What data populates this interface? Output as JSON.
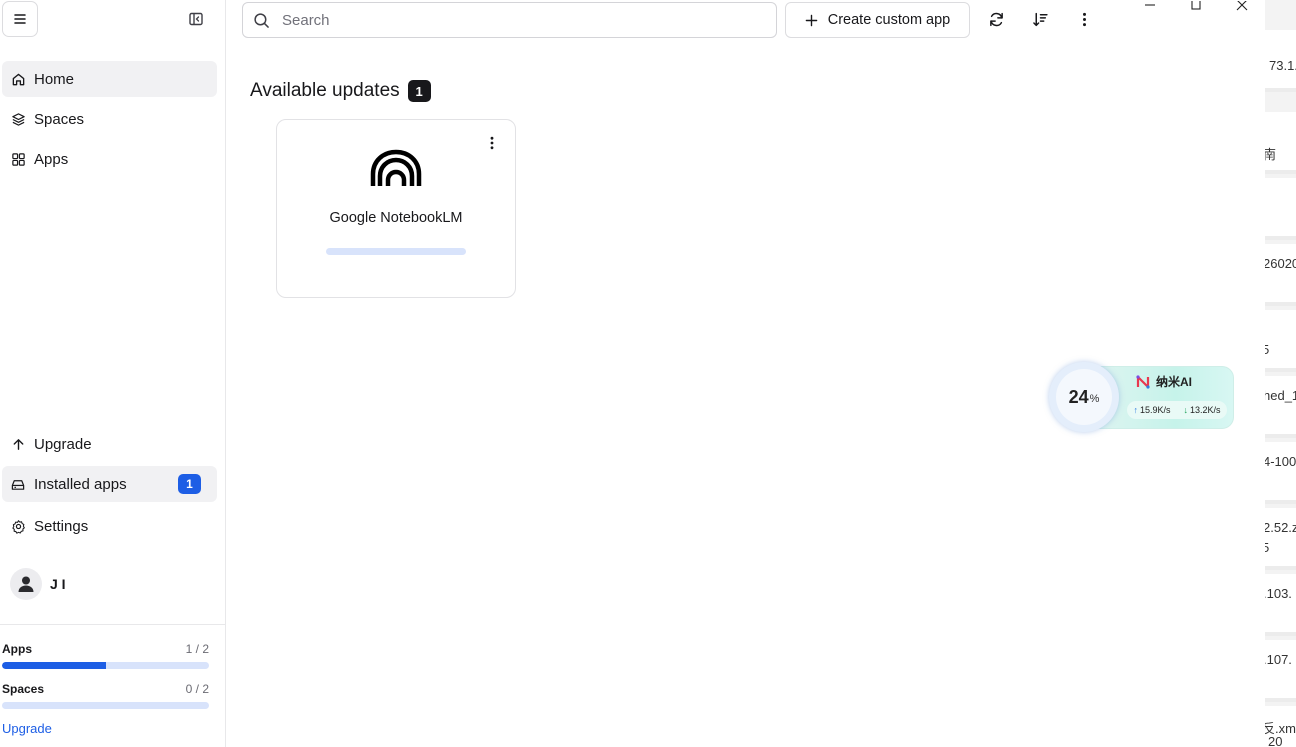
{
  "sidebar": {
    "nav": [
      {
        "label": "Home",
        "icon": "home-icon",
        "active": true
      },
      {
        "label": "Spaces",
        "icon": "layers-icon",
        "active": false
      },
      {
        "label": "Apps",
        "icon": "grid-icon",
        "active": false
      }
    ],
    "bottom_nav": [
      {
        "label": "Upgrade",
        "icon": "arrow-up-icon"
      },
      {
        "label": "Installed apps",
        "icon": "drive-icon",
        "badge": "1"
      },
      {
        "label": "Settings",
        "icon": "gear-icon"
      }
    ],
    "user": {
      "name": "J I"
    },
    "quotas": [
      {
        "label": "Apps",
        "count": "1 / 2",
        "fraction": 0.5
      },
      {
        "label": "Spaces",
        "count": "0 / 2",
        "fraction": 0
      }
    ],
    "upgrade_link": "Upgrade"
  },
  "toolbar": {
    "search_placeholder": "Search",
    "create_label": "Create custom app",
    "icons": [
      "refresh-icon",
      "sort-icon",
      "more-vertical-icon"
    ]
  },
  "main": {
    "section_title": "Available updates",
    "section_badge": "1",
    "cards": [
      {
        "name": "Google NotebookLM",
        "progress": 0
      }
    ]
  },
  "widget": {
    "percent": "24",
    "percent_sign": "%",
    "brand": "纳米AI",
    "upload": "15.9K/s",
    "download": "13.2K/s"
  },
  "background_window": {
    "snippets": [
      "73.1.",
      "南",
      "26020",
      "5",
      "hed_1",
      "4-100",
      "2.52.z",
      "5",
      ".103.",
      ".107.",
      "反.xm",
      "20"
    ]
  },
  "colors": {
    "accent": "#1d5ee5",
    "progress_track": "#d8e3fb",
    "badge_dark": "#18181b"
  }
}
